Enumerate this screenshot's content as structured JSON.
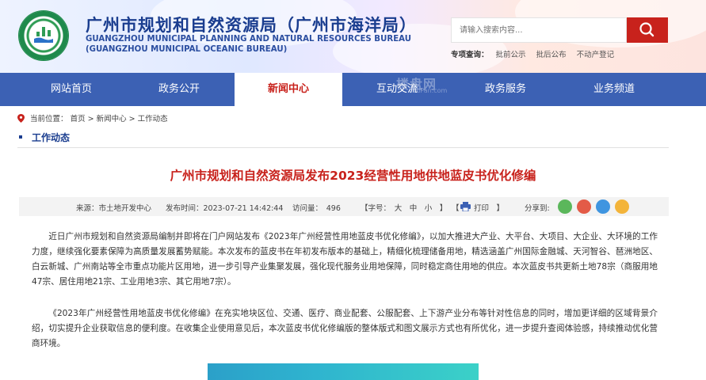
{
  "header": {
    "title_cn": "广州市规划和自然资源局（广州市海洋局）",
    "title_en_line1": "GUANGZHOU MUNICIPAL PLANNING AND NATURAL RESOURCES BUREAU",
    "title_en_line2": "(GUANGZHOU MUNICIPAL OCEANIC BUREAU)",
    "search_placeholder": "请输入搜索内容...",
    "quick_label": "专项查询：",
    "quick_links": [
      "批前公示",
      "批后公布",
      "不动产登记"
    ]
  },
  "nav": {
    "items": [
      "网站首页",
      "政务公开",
      "新闻中心",
      "互动交流",
      "政务服务",
      "业务频道"
    ],
    "active": "新闻中心",
    "watermark": "楼盘网",
    "watermark_url": "LouPan.com"
  },
  "breadcrumb": {
    "label": "当前位置：",
    "path": "首页 > 新闻中心 > 工作动态"
  },
  "section_title": "工作动态",
  "article": {
    "title": "广州市规划和自然资源局发布2023经营性用地供地蓝皮书优化修编",
    "source": "来源：市土地开发中心",
    "publish_time": "发布时间：2023-07-21 14:42:44",
    "visits": "访问量：　496",
    "font_size": "【字号：　大　中　小　】",
    "print": "打印　】",
    "print_bracket": "【",
    "share_label": "分享到:",
    "paragraphs": [
      "近日广州市规划和自然资源局编制并即将在门户网站发布《2023年广州经营性用地蓝皮书优化修编》，以加大推进大产业、大平台、大项目、大企业、大环境的工作力度，继续强化要素保障为高质量发展蓄势赋能。本次发布的蓝皮书在年初发布版本的基础上，精细化梳理储备用地，精选涵盖广州国际金融城、天河智谷、琶洲地区、白云新城、广州南站等全市重点功能片区用地，进一步引导产业集聚发展，强化现代服务业用地保障，同时稳定商住用地的供应。本次蓝皮书共更新土地78宗（商服用地47宗、居住用地21宗、工业用地3宗、其它用地7宗）。",
      "《2023年广州经营性用地蓝皮书优化修编》在充实地块区位、交通、医疗、商业配套、公服配套、上下游产业分布等针对性信息的同时，增加更详细的区域背景介绍，切实提升企业获取信息的便利度。在收集企业使用意见后，本次蓝皮书优化修编版的整体版式和图文展示方式也有所优化，进一步提升查阅体验感，持续推动优化营商环境。"
    ]
  },
  "colors": {
    "brand_blue": "#3c61b4",
    "accent_red": "#c8221c",
    "title_blue": "#1a3d8f"
  },
  "icons": [
    "location-pin-icon",
    "search-icon",
    "printer-icon",
    "wechat-icon",
    "weibo-icon",
    "qq-icon",
    "qzone-icon"
  ]
}
